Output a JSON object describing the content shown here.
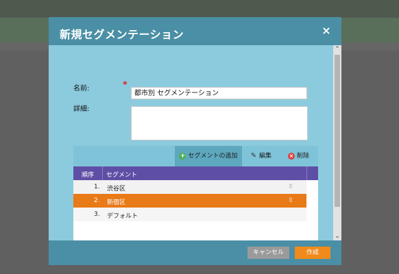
{
  "dialog": {
    "title": "新規セグメンテーション",
    "close_icon": "×"
  },
  "form": {
    "name_label": "名前:",
    "name_value": "都市別 セグメンテーション",
    "required_mark": "*",
    "detail_label": "詳細:",
    "detail_value": ""
  },
  "toolbar": {
    "add_label": "セグメントの追加",
    "edit_label": "編集",
    "delete_label": "削除",
    "icons": [
      "plus-circle-icon",
      "pencil-icon",
      "delete-circle-icon"
    ]
  },
  "table": {
    "columns": [
      "順序",
      "セグメント"
    ],
    "rows": [
      {
        "order": "1.",
        "name": "渋谷区",
        "selected": false
      },
      {
        "order": "2.",
        "name": "新宿区",
        "selected": true
      },
      {
        "order": "3.",
        "name": "デフォルト",
        "selected": false
      }
    ]
  },
  "footer": {
    "cancel_label": "キャンセル",
    "create_label": "作成"
  },
  "colors": {
    "header": "#4a8fa5",
    "body": "#8ccbdd",
    "table_header": "#5f4ea5",
    "selected_row": "#e87a18",
    "primary_button": "#f08a1c"
  }
}
